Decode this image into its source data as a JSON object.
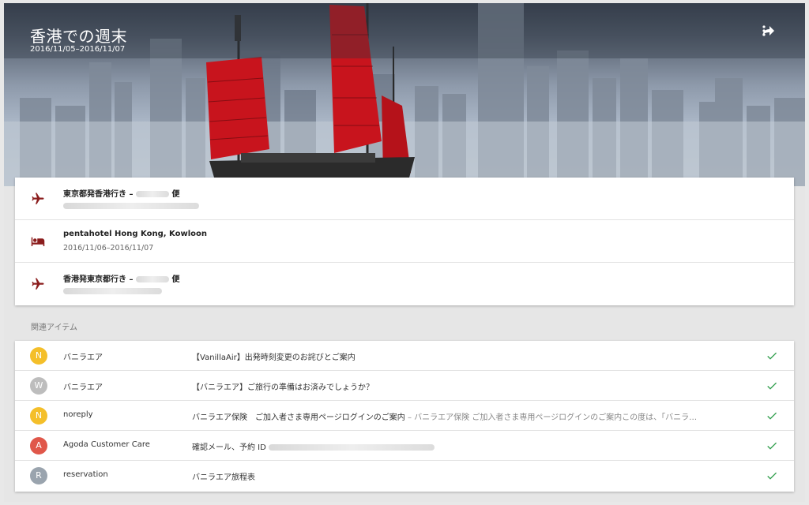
{
  "header": {
    "title": "香港での週末",
    "dates": "2016/11/05–2016/11/07",
    "share_icon": "share-icon",
    "more_icon": "more-vert-icon"
  },
  "trip_items": [
    {
      "icon": "flight-icon",
      "title_visible": "東京都発香港行き –",
      "title_suffix": "便",
      "subtitle_redacted": true
    },
    {
      "icon": "hotel-icon",
      "title_visible": "pentahotel Hong Kong, Kowloon",
      "subtitle": "2016/11/06–2016/11/07"
    },
    {
      "icon": "flight-icon",
      "title_visible": "香港発東京都行き –",
      "title_suffix": "便",
      "subtitle_redacted": true
    }
  ],
  "related_label": "関連アイテム",
  "related_items": [
    {
      "avatar_letter": "N",
      "avatar_color": "#f4bf2a",
      "sender": "バニラエア",
      "subject": "【VanillaAir】出発時刻変更のお詫びとご案内",
      "snippet": ""
    },
    {
      "avatar_letter": "W",
      "avatar_color": "#bdbdbd",
      "sender": "バニラエア",
      "subject": "【バニラエア】ご旅行の準備はお済みでしょうか？",
      "snippet": ""
    },
    {
      "avatar_letter": "N",
      "avatar_color": "#f4bf2a",
      "sender": "noreply",
      "subject": "バニラエア保険　ご加入者さま専用ページログインのご案内",
      "snippet": " – バニラエア保険 ご加入者さま専用ページログインのご案内この度は、「バニラ…"
    },
    {
      "avatar_letter": "A",
      "avatar_color": "#e0574a",
      "sender": "Agoda Customer Care",
      "subject": "確認メール、予約 ID",
      "snippet": ""
    },
    {
      "avatar_letter": "R",
      "avatar_color": "#9aa4ae",
      "sender": "reservation",
      "subject": "バニラエア旅程表",
      "snippet": ""
    }
  ],
  "colors": {
    "accent_red": "#8b1d1d",
    "check_green": "#2e9d4a"
  }
}
